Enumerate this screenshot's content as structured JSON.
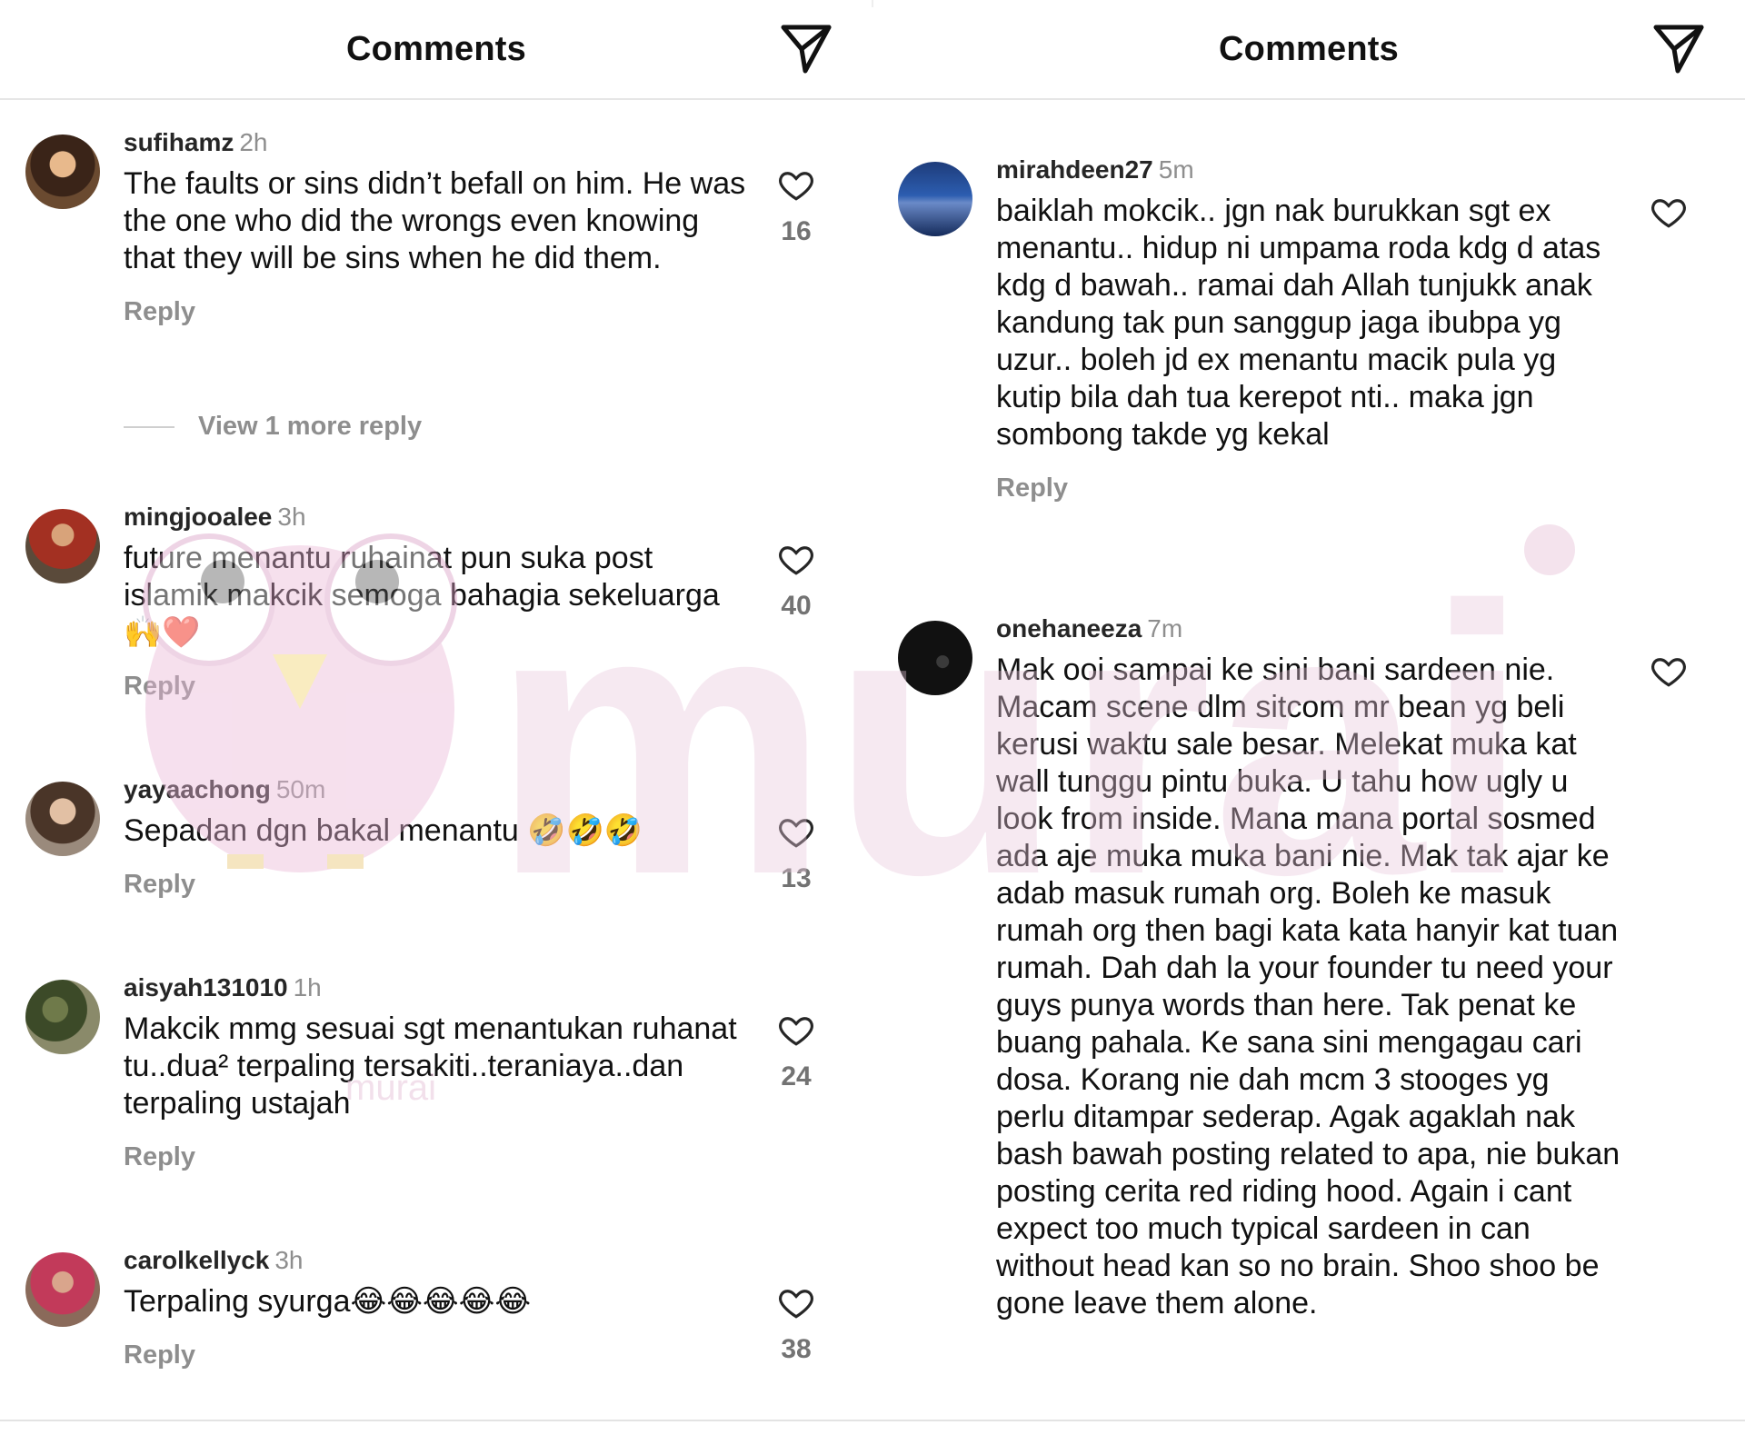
{
  "left_panel": {
    "title": "Comments",
    "view_more_reply": "View 1 more reply",
    "comments": [
      {
        "username": "sufihamz",
        "time": "2h",
        "text": "The faults or sins didn’t befall on him. He was the one who did the wrongs even knowing that they will be sins when he did them.",
        "reply": "Reply",
        "likes": "16"
      },
      {
        "username": "mingjooalee",
        "time": "3h",
        "text": "future menantu ruhainat pun suka post islamik makcik semoga bahagia sekeluarga 🙌❤️",
        "reply": "Reply",
        "likes": "40"
      },
      {
        "username": "yayaachong",
        "time": "50m",
        "text": "Sepadan dgn bakal menantu 🤣🤣🤣",
        "reply": "Reply",
        "likes": "13"
      },
      {
        "username": "aisyah131010",
        "time": "1h",
        "text": "Makcik mmg sesuai sgt menantukan ruhanat tu..dua² terpaling tersakiti..teraniaya..dan terpaling ustajah",
        "reply": "Reply",
        "likes": "24"
      },
      {
        "username": "carolkellyck",
        "time": "3h",
        "text": "Terpaling syurga😂😂😂😂😂",
        "reply": "Reply",
        "likes": "38"
      }
    ]
  },
  "right_panel": {
    "title": "Comments",
    "comments": [
      {
        "username": "mirahdeen27",
        "time": "5m",
        "text": "baiklah mokcik.. jgn nak burukkan sgt ex menantu.. hidup ni umpama roda kdg d atas kdg d bawah.. ramai dah Allah tunjukk anak kandung tak pun sanggup jaga ibubpa yg uzur.. boleh jd ex menantu macik pula yg kutip bila dah tua kerepot nti.. maka jgn sombong takde yg kekal",
        "reply": "Reply"
      },
      {
        "username": "onehaneeza",
        "time": "7m",
        "text": "Mak ooi sampai ke sini bani sardeen nie. Macam scene dlm sitcom mr bean yg beli kerusi waktu sale besar. Melekat muka kat wall tunggu pintu buka. U tahu how ugly u look from inside. Mana mana portal sosmed ada aje muka muka bani nie. Mak tak ajar ke adab masuk rumah org. Boleh ke masuk rumah org then bagi kata kata hanyir kat tuan rumah. Dah dah la your founder tu need your guys punya words than here. Tak penat ke buang pahala. Ke sana sini mengagau cari dosa. Korang nie dah mcm 3 stooges yg perlu ditampar sederap. Agak agaklah nak bash bawah posting related to apa,  nie bukan posting cerita red riding hood. Again i cant expect too much typical sardeen in can without head kan so no brain. Shoo shoo be gone leave them alone."
      }
    ]
  },
  "watermark": {
    "text": "murai",
    "small_text": "murai",
    "color": "#e9c7dc"
  },
  "colors": {
    "meta_gray": "#8e8e8e",
    "divider": "#e6e6e6",
    "text": "#111111"
  }
}
